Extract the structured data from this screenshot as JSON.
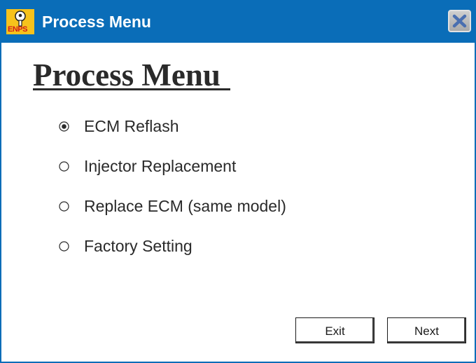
{
  "window": {
    "title": "Process Menu",
    "icon_label": "ENPS",
    "close_icon": "close-icon",
    "title_bar_color": "#0a6db8"
  },
  "main": {
    "heading": "Process Menu",
    "options": [
      {
        "label": "ECM Reflash",
        "selected": true
      },
      {
        "label": "Injector Replacement",
        "selected": false
      },
      {
        "label": "Replace ECM (same model)",
        "selected": false
      },
      {
        "label": "Factory Setting",
        "selected": false
      }
    ]
  },
  "footer": {
    "exit_label": "Exit",
    "next_label": "Next"
  }
}
